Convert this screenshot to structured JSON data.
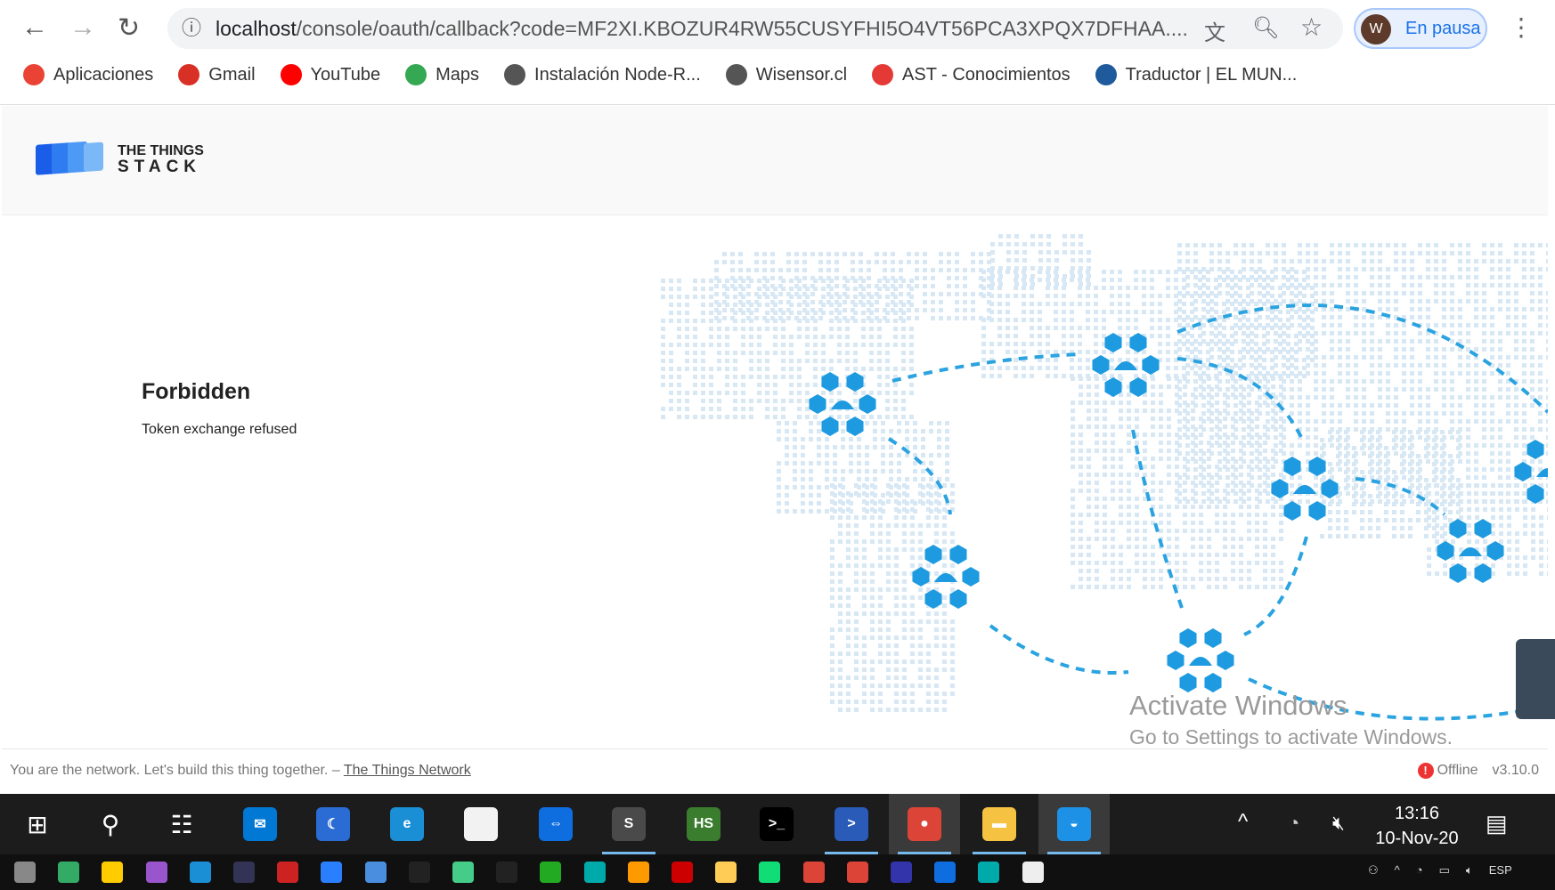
{
  "browser": {
    "url_host": "localhost",
    "url_rest": "/console/oauth/callback?code=MF2XI.KBOZUR4RW55CUSYFHI5O4VT56PCA3XPQX7DFHAA....",
    "profile_initial": "W",
    "profile_label": "En pausa",
    "bookmarks": [
      {
        "label": "Aplicaciones",
        "icon": "apps-grid-icon",
        "color": "#ea4335"
      },
      {
        "label": "Gmail",
        "icon": "gmail-icon",
        "color": "#d93025"
      },
      {
        "label": "YouTube",
        "icon": "youtube-icon",
        "color": "#ff0000"
      },
      {
        "label": "Maps",
        "icon": "maps-icon",
        "color": "#34a853"
      },
      {
        "label": "Instalación Node-R...",
        "icon": "globe-icon",
        "color": "#555555"
      },
      {
        "label": "Wisensor.cl",
        "icon": "globe-icon",
        "color": "#555555"
      },
      {
        "label": "AST - Conocimientos",
        "icon": "ast-icon",
        "color": "#e53935"
      },
      {
        "label": "Traductor | EL MUN...",
        "icon": "translator-globe-icon",
        "color": "#1e5a9c"
      }
    ]
  },
  "header": {
    "logo_line1": "THE THINGS",
    "logo_line2": "STACK"
  },
  "error": {
    "title": "Forbidden",
    "message": "Token exchange refused"
  },
  "watermark": {
    "line1": "Activate Windows",
    "line2": "Go to Settings to activate Windows."
  },
  "footer": {
    "tagline": "You are the network. Let's build this thing together. – ",
    "link": "The Things Network",
    "status": "Offline",
    "version": "v3.10.0"
  },
  "taskbar": {
    "apps": [
      {
        "name": "start-icon",
        "glyph": "⊞",
        "bg": "transparent"
      },
      {
        "name": "search-icon",
        "glyph": "⚲",
        "bg": "transparent"
      },
      {
        "name": "task-view-icon",
        "glyph": "☷",
        "bg": "transparent"
      },
      {
        "name": "mail-icon",
        "glyph": "✉",
        "bg": "#0078d4"
      },
      {
        "name": "app-moon-icon",
        "glyph": "☾",
        "bg": "#2b6cd4"
      },
      {
        "name": "edge-icon",
        "glyph": "e",
        "bg": "#1a8fd6"
      },
      {
        "name": "file-icon",
        "glyph": "",
        "bg": "#f2f2f2"
      },
      {
        "name": "teamviewer-icon",
        "glyph": "⇔",
        "bg": "#0e6ddf"
      },
      {
        "name": "sublime-icon",
        "glyph": "S",
        "bg": "#4a4a4a",
        "run": true
      },
      {
        "name": "hs-icon",
        "glyph": "HS",
        "bg": "#3b7d2f"
      },
      {
        "name": "terminal-icon",
        "glyph": ">_",
        "bg": "#000000"
      },
      {
        "name": "powershell-icon",
        "glyph": ">",
        "bg": "#2a5bb8",
        "run": true
      },
      {
        "name": "chrome-icon",
        "glyph": "●",
        "bg": "#db4437",
        "run": true,
        "active": true
      },
      {
        "name": "file-explorer-icon",
        "glyph": "▬",
        "bg": "#f5c242",
        "run": true
      },
      {
        "name": "docker-icon",
        "glyph": "◒",
        "bg": "#1d91e6",
        "run": true,
        "active": true
      }
    ],
    "time": "13:16",
    "date": "10-Nov-20",
    "lang": "ESP"
  }
}
